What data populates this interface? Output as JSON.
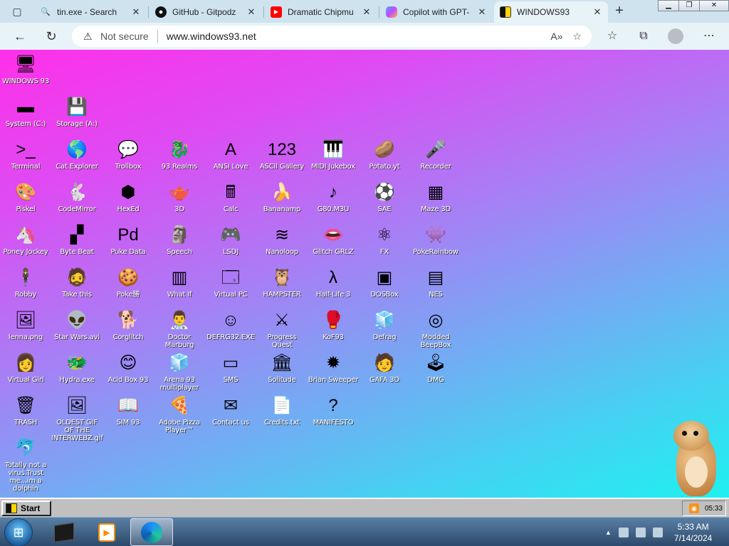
{
  "browser": {
    "tabs": [
      {
        "label": "tin.exe - Search",
        "icon": "search-icon",
        "color": "#1a73e8"
      },
      {
        "label": "GitHub - Gitpodz",
        "icon": "github-icon",
        "color": "#111111"
      },
      {
        "label": "Dramatic Chipmu",
        "icon": "youtube-icon",
        "color": "#ff0000"
      },
      {
        "label": "Copilot with GPT-",
        "icon": "copilot-icon",
        "color": "#7f5af0"
      },
      {
        "label": "WINDOWS93",
        "icon": "windows93-icon",
        "color": "#d4b000"
      }
    ],
    "new_tab": "+",
    "address": {
      "security": "Not secure",
      "url": "www.windows93.net"
    }
  },
  "desktop": {
    "icons": [
      {
        "label": "WINDOWS 93",
        "glyph": "🖥"
      },
      {
        "label": "System (C:)",
        "glyph": "▬"
      },
      {
        "label": "Storage (A:)",
        "glyph": "💾"
      },
      {
        "label": "Terminal",
        "glyph": ">_"
      },
      {
        "label": "Cat Explorer",
        "glyph": "🌎"
      },
      {
        "label": "Trollbox",
        "glyph": "💬"
      },
      {
        "label": "93 Realms",
        "glyph": "🐉"
      },
      {
        "label": "ANSI Love",
        "glyph": "A"
      },
      {
        "label": "ASCII Gallery",
        "glyph": "123"
      },
      {
        "label": "MIDI Jukebox",
        "glyph": "🎹"
      },
      {
        "label": "Potato.yt",
        "glyph": "🥔"
      },
      {
        "label": "Recorder",
        "glyph": "🎤"
      },
      {
        "label": "Piskel",
        "glyph": "🎨"
      },
      {
        "label": "CodeMirror",
        "glyph": "🐇"
      },
      {
        "label": "HexEd",
        "glyph": "⬢"
      },
      {
        "label": "3D",
        "glyph": "🫖"
      },
      {
        "label": "Calc",
        "glyph": "🖩"
      },
      {
        "label": "Bananamp",
        "glyph": "🍌"
      },
      {
        "label": "G80.M3U",
        "glyph": "♪"
      },
      {
        "label": "SAE",
        "glyph": "⚽"
      },
      {
        "label": "Maze 3D",
        "glyph": "▦"
      },
      {
        "label": "Poney Jockey",
        "glyph": "🦄"
      },
      {
        "label": "Byte Beat",
        "glyph": "▞"
      },
      {
        "label": "Puke Data",
        "glyph": "Pd"
      },
      {
        "label": "Speech",
        "glyph": "🗿"
      },
      {
        "label": "LSDJ",
        "glyph": "🎮"
      },
      {
        "label": "Nanoloop",
        "glyph": "≋"
      },
      {
        "label": "Glitch GRLZ",
        "glyph": "👄"
      },
      {
        "label": "FX",
        "glyph": "⚛"
      },
      {
        "label": "PokeRainbow",
        "glyph": "👾"
      },
      {
        "label": "Robby",
        "glyph": "🕴"
      },
      {
        "label": "Take this",
        "glyph": "🧔"
      },
      {
        "label": "Poke勝",
        "glyph": "🍪"
      },
      {
        "label": "What If",
        "glyph": "▥"
      },
      {
        "label": "Virtual PC",
        "glyph": "🗔"
      },
      {
        "label": "HAMPSTER",
        "glyph": "🦉"
      },
      {
        "label": "Half-Life 3",
        "glyph": "λ"
      },
      {
        "label": "DOSBox",
        "glyph": "▣"
      },
      {
        "label": "NES",
        "glyph": "▤"
      },
      {
        "label": "lenna.png",
        "glyph": "🖼"
      },
      {
        "label": "Star Wars.avi",
        "glyph": "👽"
      },
      {
        "label": "Corglitch",
        "glyph": "🐕"
      },
      {
        "label": "Doctor Marburg",
        "glyph": "👨‍⚕️"
      },
      {
        "label": "DEFRG32.EXE",
        "glyph": "☺"
      },
      {
        "label": "Progress Quest",
        "glyph": "⚔"
      },
      {
        "label": "KoF93",
        "glyph": "🥊"
      },
      {
        "label": "Defrag",
        "glyph": "🧊"
      },
      {
        "label": "Modded BeepBox",
        "glyph": "◎"
      },
      {
        "label": "Virtual Girl",
        "glyph": "👩"
      },
      {
        "label": "Hydra.exe",
        "glyph": "🐲"
      },
      {
        "label": "Acid Box 93",
        "glyph": "😊"
      },
      {
        "label": "Arena 93 multiplayer",
        "glyph": "🧊"
      },
      {
        "label": "SMS",
        "glyph": "▭"
      },
      {
        "label": "Solitude",
        "glyph": "🏛"
      },
      {
        "label": "Brian Sweeper",
        "glyph": "✹"
      },
      {
        "label": "GAFA 3D",
        "glyph": "🧑"
      },
      {
        "label": "DMG",
        "glyph": "🕹"
      },
      {
        "label": "TRASH",
        "glyph": "🗑"
      },
      {
        "label": "OLDEST GIF OF THE INTERWEBZ.gif",
        "glyph": "🖼"
      },
      {
        "label": "SIM 93",
        "glyph": "📖"
      },
      {
        "label": "Adobe Pizza Player™",
        "glyph": "🍕"
      },
      {
        "label": "Contact us",
        "glyph": "✉"
      },
      {
        "label": "Credits.txt",
        "glyph": "📄"
      },
      {
        "label": "MANIFESTO",
        "glyph": "?"
      },
      {
        "label": "Totally not a virus.Trust me...im a dolphin",
        "glyph": "🐬"
      }
    ]
  },
  "win93_taskbar": {
    "start_label": "Start",
    "tray_time": "05:33"
  },
  "win7_taskbar": {
    "time": "5:33 AM",
    "date": "7/14/2024"
  }
}
